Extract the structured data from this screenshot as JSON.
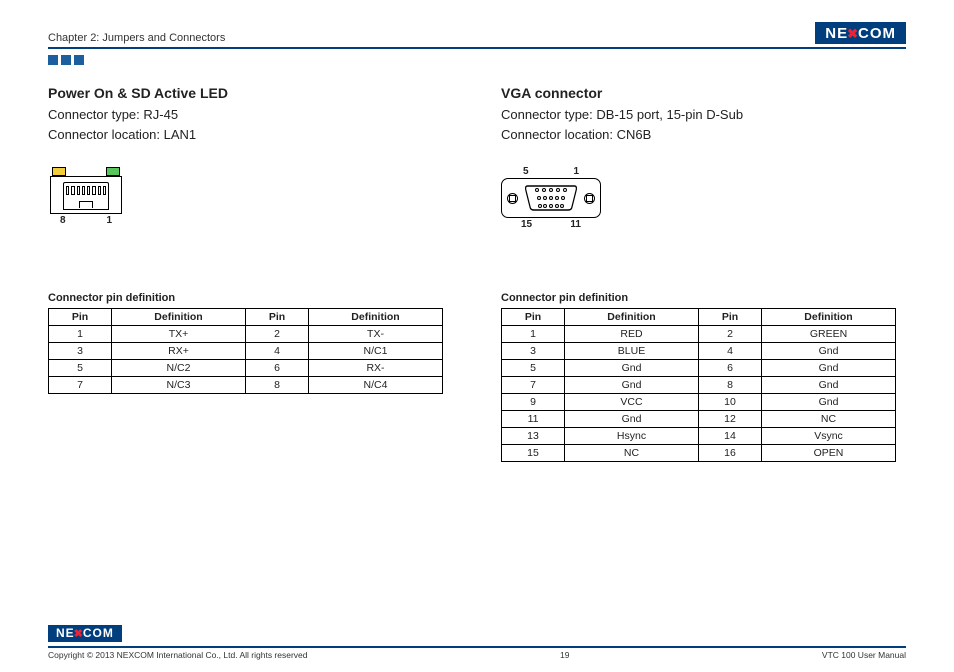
{
  "header": {
    "chapter": "Chapter 2: Jumpers and Connectors",
    "logo_text_pre": "NE",
    "logo_text_x": "✖",
    "logo_text_post": "COM"
  },
  "left": {
    "title": "Power On & SD Active LED",
    "type_line": "Connector type: RJ-45",
    "loc_line": "Connector location: LAN1",
    "label_pin8": "8",
    "label_pin1": "1",
    "subtitle": "Connector pin definition",
    "table": {
      "headers": [
        "Pin",
        "Definition",
        "Pin",
        "Definition"
      ],
      "rows": [
        [
          "1",
          "TX+",
          "2",
          "TX-"
        ],
        [
          "3",
          "RX+",
          "4",
          "N/C1"
        ],
        [
          "5",
          "N/C2",
          "6",
          "RX-"
        ],
        [
          "7",
          "N/C3",
          "8",
          "N/C4"
        ]
      ]
    }
  },
  "right": {
    "title": "VGA connector",
    "type_line": "Connector type: DB-15 port, 15-pin D-Sub",
    "loc_line": "Connector location: CN6B",
    "label_top_l": "5",
    "label_top_r": "1",
    "label_bot_l": "15",
    "label_bot_r": "11",
    "subtitle": "Connector pin definition",
    "table": {
      "headers": [
        "Pin",
        "Definition",
        "Pin",
        "Definition"
      ],
      "rows": [
        [
          "1",
          "RED",
          "2",
          "GREEN"
        ],
        [
          "3",
          "BLUE",
          "4",
          "Gnd"
        ],
        [
          "5",
          "Gnd",
          "6",
          "Gnd"
        ],
        [
          "7",
          "Gnd",
          "8",
          "Gnd"
        ],
        [
          "9",
          "VCC",
          "10",
          "Gnd"
        ],
        [
          "11",
          "Gnd",
          "12",
          "NC"
        ],
        [
          "13",
          "Hsync",
          "14",
          "Vsync"
        ],
        [
          "15",
          "NC",
          "16",
          "OPEN"
        ]
      ]
    }
  },
  "footer": {
    "copyright": "Copyright © 2013 NEXCOM International Co., Ltd. All rights reserved",
    "page_num": "19",
    "manual": "VTC 100 User Manual"
  }
}
